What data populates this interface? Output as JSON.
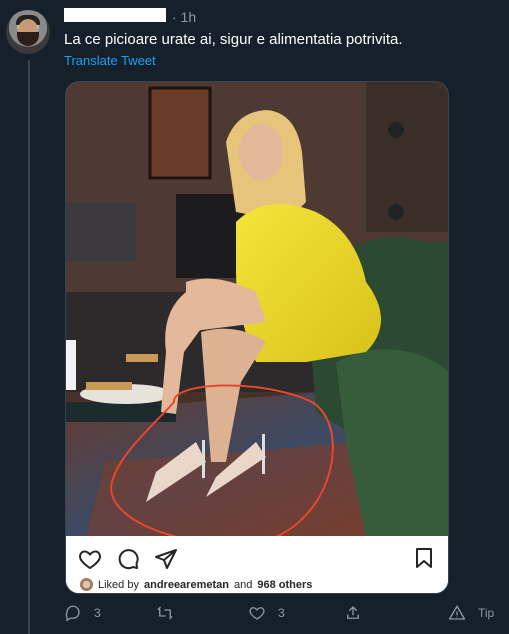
{
  "tweet": {
    "time": "· 1h",
    "text": "La ce picioare urate ai, sigur e alimentatia potrivita.",
    "translate_label": "Translate Tweet"
  },
  "embed": {
    "liked_prefix": "Liked by",
    "liked_user": "andreearemetan",
    "liked_and": "and",
    "liked_others": "968 others"
  },
  "actions": {
    "reply_count": "3",
    "retweet_count": "",
    "like_count": "3",
    "tip_label": "Tip"
  },
  "colors": {
    "background": "#15202b",
    "accent": "#1da1f2",
    "muted": "#8899a6",
    "circle_annotation": "#e8462e"
  },
  "icons": [
    "reply-icon",
    "retweet-icon",
    "like-icon",
    "share-icon",
    "tip-icon",
    "heart-icon",
    "comment-icon",
    "direct-icon",
    "bookmark-icon"
  ]
}
